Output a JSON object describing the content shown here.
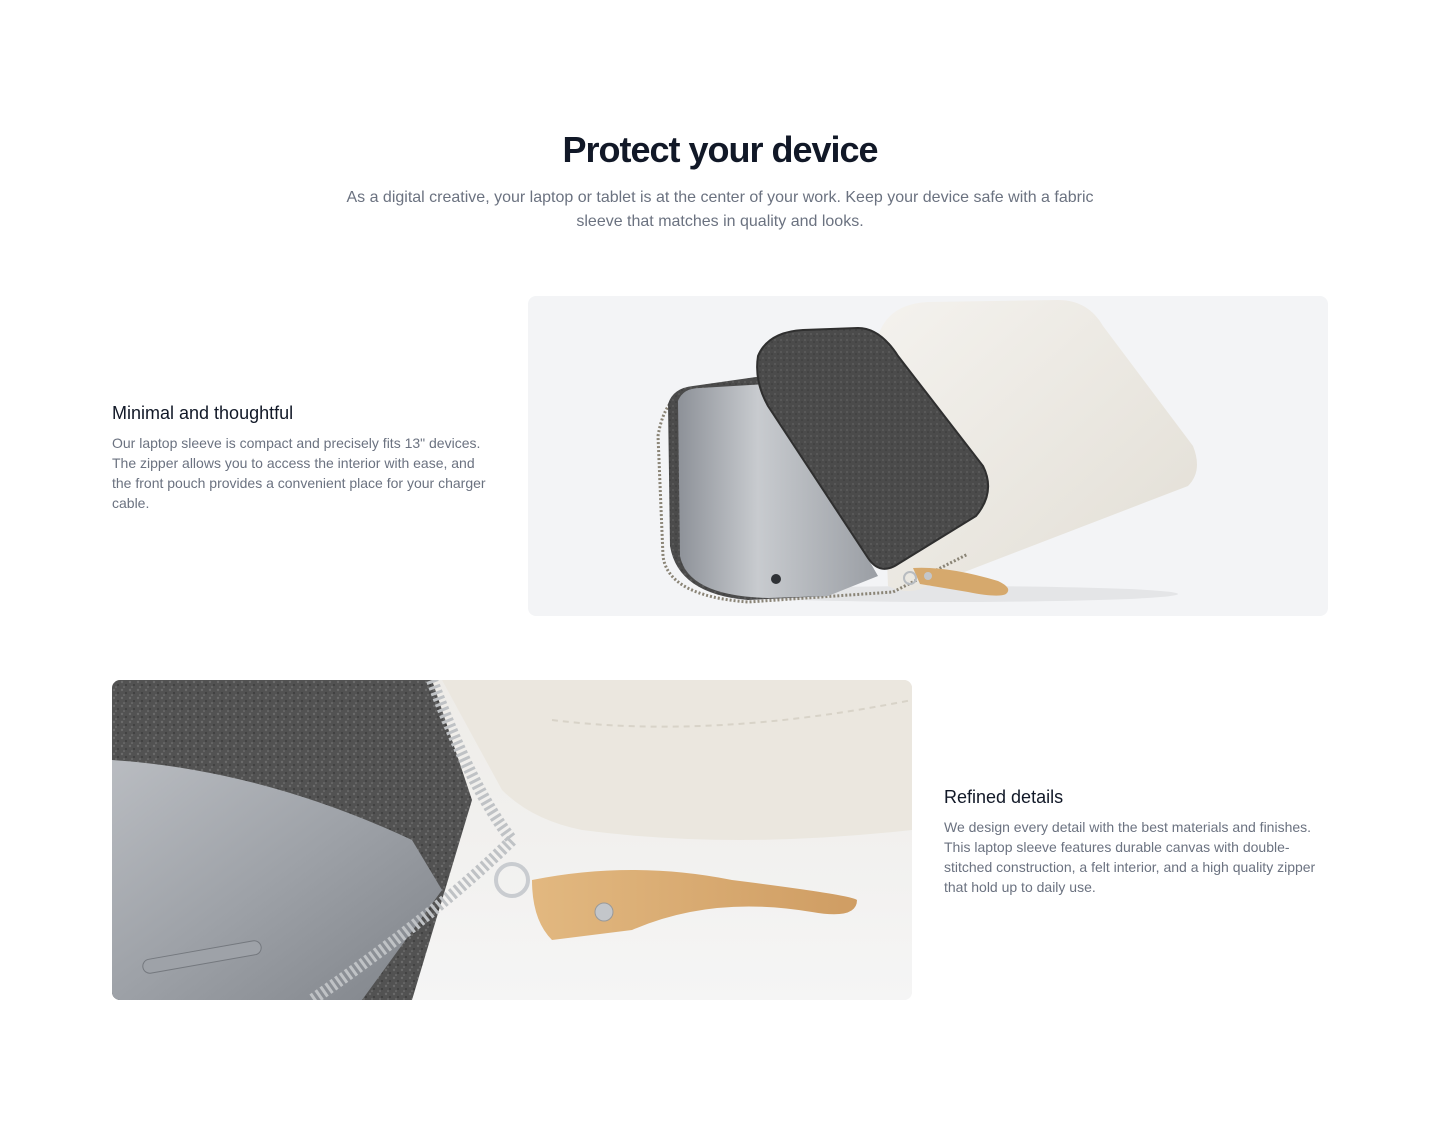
{
  "section": {
    "title": "Protect your device",
    "subtitle": "As a digital creative, your laptop or tablet is at the center of your work. Keep your device safe with a fabric sleeve that matches in quality and looks."
  },
  "features": [
    {
      "heading": "Minimal and thoughtful",
      "description": "Our laptop sleeve is compact and precisely fits 13\" devices. The zipper allows you to access the interior with ease, and the front pouch provides a convenient place for your charger cable.",
      "image_subject": "sleeve-with-tablet"
    },
    {
      "heading": "Refined details",
      "description": "We design every detail with the best materials and finishes. This laptop sleeve features durable canvas with double-stitched construction, a felt interior, and a high quality zipper that hold up to daily use.",
      "image_subject": "zipper-closeup"
    }
  ],
  "colors": {
    "heading": "#111827",
    "body_text": "#6b7280",
    "image_bg": "#f3f4f6",
    "canvas": "#ebe8e1",
    "felt": "#4a4a4a",
    "leather": "#d9ae74",
    "metal": "#a8acb2"
  }
}
